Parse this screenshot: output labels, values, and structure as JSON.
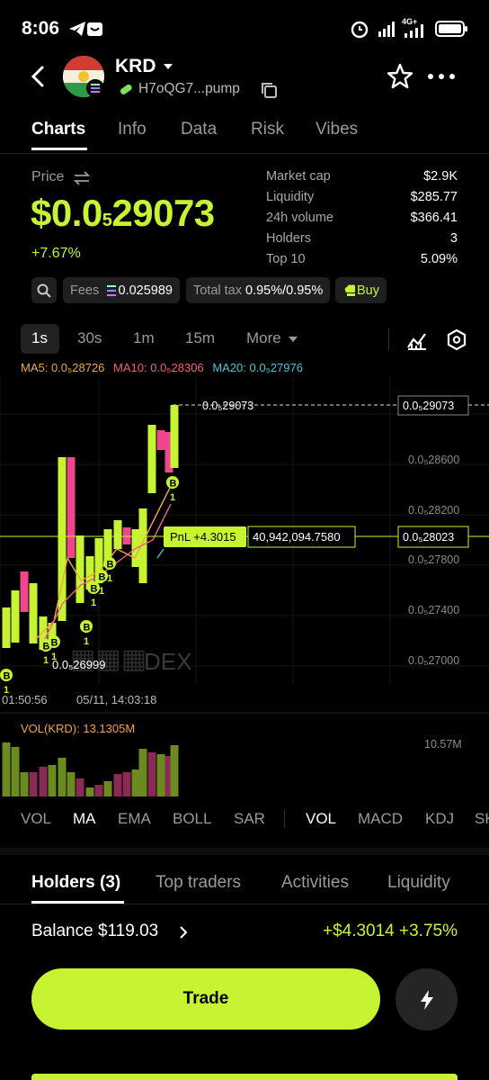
{
  "status": {
    "time": "8:06",
    "battery": "100",
    "network": "4G+"
  },
  "token": {
    "name": "KRD",
    "address": "H7oQG7...pump"
  },
  "tabs": [
    "Charts",
    "Info",
    "Data",
    "Risk",
    "Vibes"
  ],
  "price": {
    "label": "Price",
    "value_prefix": "$0.0",
    "value_sub": "5",
    "value_rest": "29073",
    "change": "+7.67%"
  },
  "stats": [
    {
      "label": "Market cap",
      "value": "$2.9K"
    },
    {
      "label": "Liquidity",
      "value": "$285.77"
    },
    {
      "label": "24h volume",
      "value": "$366.41"
    },
    {
      "label": "Holders",
      "value": "3"
    },
    {
      "label": "Top 10",
      "value": "5.09%"
    }
  ],
  "chips": {
    "fees_label": "Fees",
    "fees_value": "0.025989",
    "tax_label": "Total tax",
    "tax_value": "0.95%/0.95%",
    "buy_label": "Buy"
  },
  "timeframes": [
    "1s",
    "30s",
    "1m",
    "15m",
    "More"
  ],
  "ma": {
    "ma5": "MA5: 0.0₅28726",
    "ma10": "MA10: 0.0₅28306",
    "ma20": "MA20: 0.0₅27976",
    "color_ma5": "#f5a442",
    "color_ma10": "#f0637a",
    "color_ma20": "#4fc3d6"
  },
  "chart_data": {
    "type": "candlestick",
    "y_ticks": [
      "0.0₅28600",
      "0.0₅28200",
      "0.0₅27800",
      "0.0₅27400",
      "0.0₅27000"
    ],
    "x_labels": [
      "01:50:56",
      "05/11, 14:03:18"
    ],
    "current_price": "0.0₅29073",
    "avg_price": "0.0₅28023",
    "low_label": "0.0₅26999",
    "pnl_label": "PnL +4.3015",
    "pnl_value": "40,942,094.7580",
    "volume_label": "VOL(KRD): 13.1305M",
    "volume_max": "10.57M",
    "watermark": "DEX",
    "buy_marker": "B",
    "buy_count": "1",
    "up_color": "#c6f432",
    "down_color": "#f0458f"
  },
  "indicators": [
    "VOL",
    "MA",
    "EMA",
    "BOLL",
    "SAR",
    "VOL",
    "MACD",
    "KDJ",
    "SK"
  ],
  "bottom_tabs": [
    "Holders (3)",
    "Top traders",
    "Activities",
    "Liquidity"
  ],
  "balance": {
    "label": "Balance $119.03",
    "pnl": "+$4.3014 +3.75%"
  },
  "trade": {
    "label": "Trade"
  }
}
